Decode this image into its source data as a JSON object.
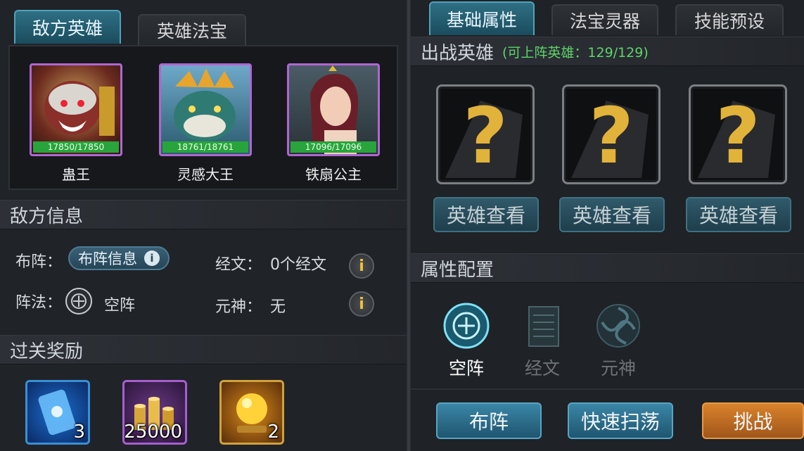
{
  "left": {
    "tabs": [
      {
        "label": "敌方英雄",
        "active": true
      },
      {
        "label": "英雄法宝",
        "active": false
      }
    ],
    "enemy_heroes": [
      {
        "name": "蛊王",
        "hp": "17850/17850"
      },
      {
        "name": "灵感大王",
        "hp": "18761/18761"
      },
      {
        "name": "铁扇公主",
        "hp": "17096/17096"
      }
    ],
    "enemy_info": {
      "title": "敌方信息",
      "formation_label": "布阵：",
      "formation_button": "布阵信息",
      "scripture_label": "经文：",
      "scripture_value": "0个经文",
      "array_label": "阵法：",
      "array_value": "空阵",
      "spirit_label": "元神：",
      "spirit_value": "无"
    },
    "rewards": {
      "title": "过关奖励",
      "items": [
        {
          "icon": "blue-talisman-icon",
          "count": "3"
        },
        {
          "icon": "gold-coins-icon",
          "count": "25000"
        },
        {
          "icon": "golden-orb-icon",
          "count": "2"
        }
      ]
    }
  },
  "right": {
    "tabs": [
      {
        "label": "基础属性",
        "active": true
      },
      {
        "label": "法宝灵器",
        "active": false
      },
      {
        "label": "技能预设",
        "active": false
      }
    ],
    "battle_heroes": {
      "title": "出战英雄",
      "subtitle": "(可上阵英雄：129/129)",
      "view_label": "英雄查看"
    },
    "attr_config": {
      "title": "属性配置",
      "items": [
        {
          "label": "空阵",
          "active": true
        },
        {
          "label": "经文",
          "active": false
        },
        {
          "label": "元神",
          "active": false
        }
      ]
    },
    "actions": {
      "formation": "布阵",
      "sweep": "快速扫荡",
      "challenge": "挑战"
    }
  },
  "colors": {
    "tab_active": "#2f6f84",
    "hp_green": "#29a43c",
    "subtitle_green": "#5fd36a",
    "challenge_orange": "#d9822b",
    "info_yellow": "#f2c230"
  }
}
